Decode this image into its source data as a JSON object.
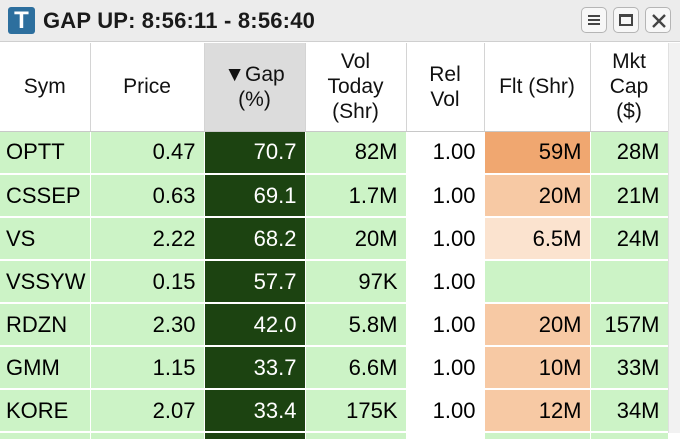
{
  "window": {
    "title_prefix": "GAP UP:",
    "title_time": "8:56:11 - 8:56:40",
    "logo_letter": "T",
    "buttons": {
      "menu": "menu-icon",
      "maximize": "maximize-icon",
      "close": "close-icon"
    }
  },
  "table": {
    "sort_indicator": "▼",
    "headers": [
      {
        "key": "sym",
        "lines": [
          "Sym"
        ]
      },
      {
        "key": "price",
        "lines": [
          "Price"
        ]
      },
      {
        "key": "gap",
        "lines": [
          "▼Gap",
          "(%)"
        ]
      },
      {
        "key": "vol",
        "lines": [
          "Vol",
          "Today",
          "(Shr)"
        ]
      },
      {
        "key": "rel",
        "lines": [
          "Rel",
          "Vol"
        ]
      },
      {
        "key": "flt",
        "lines": [
          "Flt (Shr)"
        ]
      },
      {
        "key": "mktcap",
        "lines": [
          "Mkt",
          "Cap",
          "($)"
        ]
      }
    ],
    "rows": [
      {
        "sym": "OPTT",
        "price": "0.47",
        "gap": "70.7",
        "vol": "82M",
        "rel": "1.00",
        "flt": "59M",
        "mktcap": "28M"
      },
      {
        "sym": "CSSEP",
        "price": "0.63",
        "gap": "69.1",
        "vol": "1.7M",
        "rel": "1.00",
        "flt": "20M",
        "mktcap": "21M"
      },
      {
        "sym": "VS",
        "price": "2.22",
        "gap": "68.2",
        "vol": "20M",
        "rel": "1.00",
        "flt": "6.5M",
        "mktcap": "24M"
      },
      {
        "sym": "VSSYW",
        "price": "0.15",
        "gap": "57.7",
        "vol": "97K",
        "rel": "1.00",
        "flt": "",
        "mktcap": ""
      },
      {
        "sym": "RDZN",
        "price": "2.30",
        "gap": "42.0",
        "vol": "5.8M",
        "rel": "1.00",
        "flt": "20M",
        "mktcap": "157M"
      },
      {
        "sym": "GMM",
        "price": "1.15",
        "gap": "33.7",
        "vol": "6.6M",
        "rel": "1.00",
        "flt": "10M",
        "mktcap": "33M"
      },
      {
        "sym": "KORE",
        "price": "2.07",
        "gap": "33.4",
        "vol": "175K",
        "rel": "1.00",
        "flt": "12M",
        "mktcap": "34M"
      }
    ],
    "colors": {
      "row_bg": "#ccf3c6",
      "gap_bg": "#1c4311",
      "gap_fg": "#ffffff",
      "rel_bg": "#ffffff",
      "flt_shades": [
        "#f0a770",
        "#f7c9a4",
        "#fbe3cf"
      ]
    }
  }
}
